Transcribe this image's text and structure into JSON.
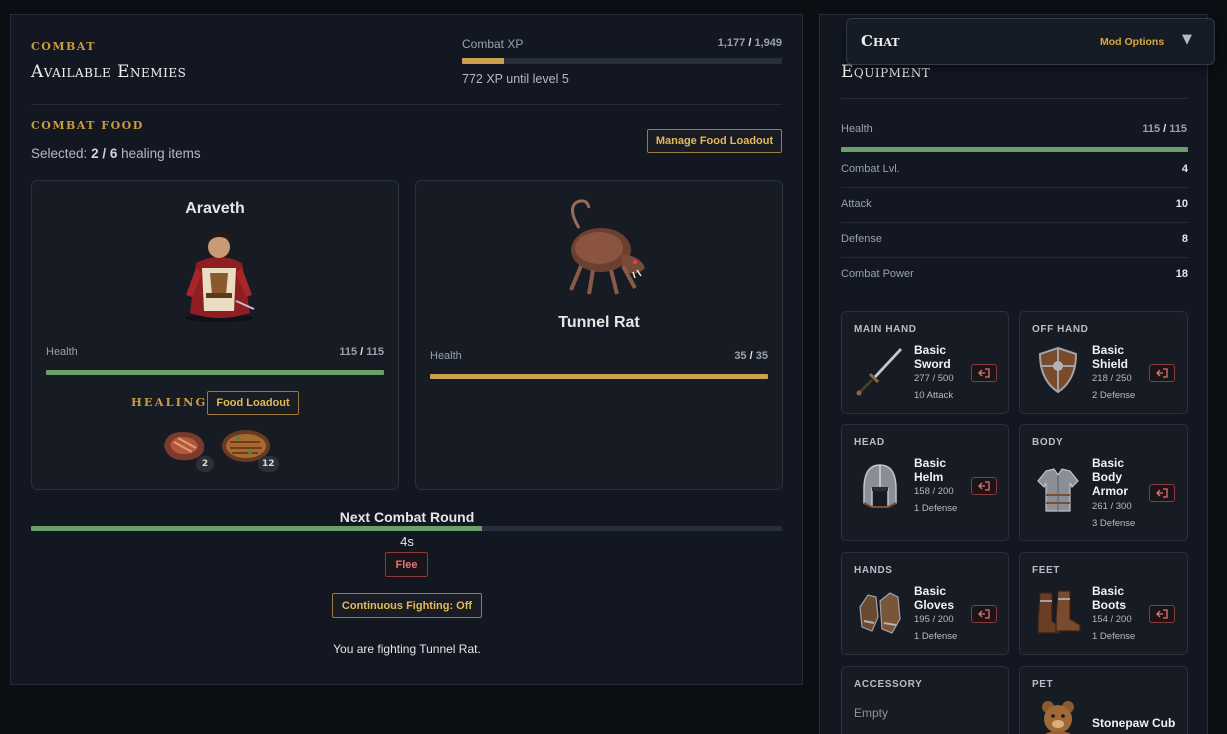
{
  "combat": {
    "kicker": "Combat",
    "title": "Available Enemies",
    "xp_label": "Combat XP",
    "xp_current": "1,177",
    "xp_sep": "/",
    "xp_max": "1,949",
    "xp_progress": 0.13,
    "xp_until": "772 XP until level 5"
  },
  "food": {
    "kicker": "Combat Food",
    "selected_prefix": "Selected:",
    "selected_count": "2 / 6",
    "selected_suffix": "healing items",
    "manage_button": "Manage Food Loadout"
  },
  "player": {
    "name": "Araveth",
    "health_label": "Health",
    "health_current": "115",
    "health_sep": "/",
    "health_max": "115",
    "health_fraction": 1.0,
    "healing_label": "Healing",
    "food_loadout_button": "Food Loadout",
    "food_items": [
      {
        "icon": "meat-icon",
        "count": "2"
      },
      {
        "icon": "cooked-fish-icon",
        "count": "12"
      }
    ]
  },
  "enemy": {
    "name": "Tunnel Rat",
    "health_label": "Health",
    "health_current": "35",
    "health_sep": "/",
    "health_max": "35",
    "health_fraction": 1.0
  },
  "round": {
    "title": "Next Combat Round",
    "progress": 0.6,
    "timer": "4s",
    "flee_button": "Flee",
    "continuous_button": "Continuous Fighting: Off",
    "status": "You are fighting Tunnel Rat."
  },
  "equipment": {
    "title": "Equipment",
    "health_label": "Health",
    "health_current": "115",
    "health_sep": "/",
    "health_max": "115",
    "health_fraction": 1.0,
    "stats": [
      {
        "label": "Combat Lvl.",
        "value": "4"
      },
      {
        "label": "Attack",
        "value": "10"
      },
      {
        "label": "Defense",
        "value": "8"
      },
      {
        "label": "Combat Power",
        "value": "18"
      }
    ],
    "slots": {
      "main_hand": {
        "label": "MAIN HAND",
        "name": "Basic Sword",
        "durability": "277 / 500",
        "bonus": "10 Attack",
        "icon": "sword-icon"
      },
      "off_hand": {
        "label": "OFF HAND",
        "name": "Basic Shield",
        "durability": "218 / 250",
        "bonus": "2 Defense",
        "icon": "shield-icon"
      },
      "head": {
        "label": "HEAD",
        "name": "Basic Helm",
        "durability": "158 / 200",
        "bonus": "1 Defense",
        "icon": "helm-icon"
      },
      "body": {
        "label": "BODY",
        "name": "Basic Body Armor",
        "durability": "261 / 300",
        "bonus": "3 Defense",
        "icon": "body-armor-icon"
      },
      "hands": {
        "label": "HANDS",
        "name": "Basic Gloves",
        "durability": "195 / 200",
        "bonus": "1 Defense",
        "icon": "gloves-icon"
      },
      "feet": {
        "label": "FEET",
        "name": "Basic Boots",
        "durability": "154 / 200",
        "bonus": "1 Defense",
        "icon": "boots-icon"
      },
      "accessory": {
        "label": "ACCESSORY",
        "empty": "Empty"
      },
      "pet": {
        "label": "PET",
        "name": "Stonepaw Cub",
        "icon": "bear-cub-icon"
      }
    }
  },
  "chat": {
    "title": "Chat",
    "mod_options": "Mod Options",
    "toggle": "▼"
  },
  "colors": {
    "accent_gold": "#c99a3e",
    "health_green": "#6a9f6a",
    "danger_red": "#e57373"
  }
}
